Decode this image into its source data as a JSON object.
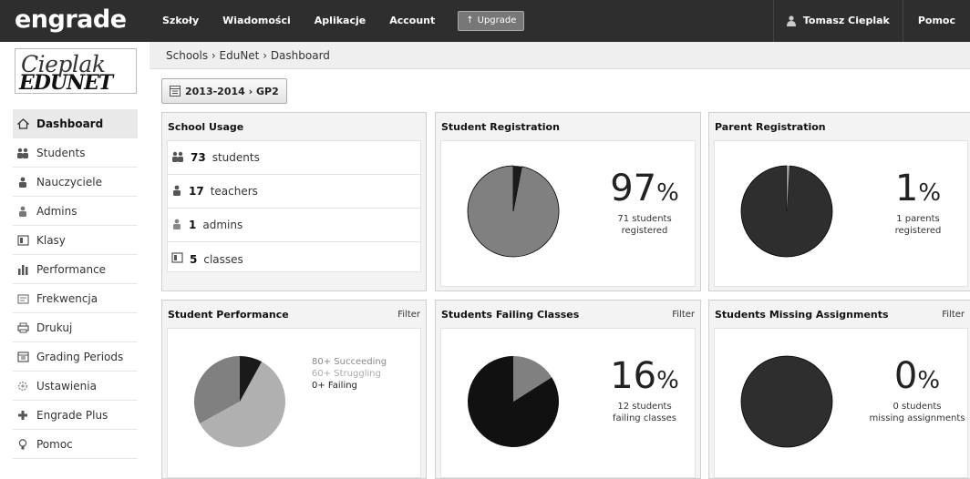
{
  "header": {
    "logo": "engrade",
    "nav": [
      "Szkoły",
      "Wiadomości",
      "Aplikacje",
      "Account"
    ],
    "upgrade_label": "Upgrade",
    "user_name": "Tomasz Cieplak",
    "help_label": "Pomoc"
  },
  "school_logo": {
    "line1": "Cieplak",
    "line2": "EDUNET"
  },
  "sidebar": {
    "items": [
      {
        "label": "Dashboard",
        "icon": "home-icon"
      },
      {
        "label": "Students",
        "icon": "students-icon"
      },
      {
        "label": "Nauczyciele",
        "icon": "teacher-icon"
      },
      {
        "label": "Admins",
        "icon": "admin-icon"
      },
      {
        "label": "Klasy",
        "icon": "class-icon"
      },
      {
        "label": "Performance",
        "icon": "performance-icon"
      },
      {
        "label": "Frekwencja",
        "icon": "attendance-icon"
      },
      {
        "label": "Drukuj",
        "icon": "print-icon"
      },
      {
        "label": "Grading Periods",
        "icon": "calendar-icon"
      },
      {
        "label": "Ustawienia",
        "icon": "gear-icon"
      },
      {
        "label": "Engrade Plus",
        "icon": "plus-icon"
      },
      {
        "label": "Pomoc",
        "icon": "help-icon"
      }
    ]
  },
  "breadcrumb": "Schools › EduNet › Dashboard",
  "period": "2013-2014 › GP2",
  "school_usage": {
    "title": "School Usage",
    "rows": [
      {
        "count": "73",
        "label": "students"
      },
      {
        "count": "17",
        "label": "teachers"
      },
      {
        "count": "1",
        "label": "admins"
      },
      {
        "count": "5",
        "label": "classes"
      }
    ]
  },
  "student_registration": {
    "title": "Student Registration",
    "value": "97",
    "unit": "%",
    "line1": "71 students",
    "line2": "registered",
    "fraction_registered": 0.97
  },
  "parent_registration": {
    "title": "Parent Registration",
    "value": "1",
    "unit": "%",
    "line1": "1 parents",
    "line2": "registered",
    "fraction_registered": 0.01
  },
  "student_performance": {
    "title": "Student Performance",
    "filter": "Filter",
    "legend": [
      "80+ Succeeding",
      "60+ Struggling",
      "0+ Failing"
    ],
    "colors": [
      "#808080",
      "#b0b0b0",
      "#1a1a1a"
    ]
  },
  "students_failing": {
    "title": "Students Failing Classes",
    "filter": "Filter",
    "value": "16",
    "unit": "%",
    "line1": "12 students",
    "line2": "failing classes",
    "fraction_failing": 0.16
  },
  "students_missing": {
    "title": "Students Missing Assignments",
    "filter": "Filter",
    "value": "0",
    "unit": "%",
    "line1": "0 students",
    "line2": "missing assignments",
    "fraction_missing": 0
  },
  "chart_data": [
    {
      "type": "pie",
      "title": "Student Registration",
      "slices": [
        {
          "label": "registered",
          "value": 97
        },
        {
          "label": "not registered",
          "value": 3
        }
      ]
    },
    {
      "type": "pie",
      "title": "Parent Registration",
      "slices": [
        {
          "label": "registered",
          "value": 1
        },
        {
          "label": "not registered",
          "value": 99
        }
      ]
    },
    {
      "type": "pie",
      "title": "Student Performance",
      "slices": [
        {
          "label": "80+ Succeeding",
          "value": 33
        },
        {
          "label": "60+ Struggling",
          "value": 59
        },
        {
          "label": "0+ Failing",
          "value": 8
        }
      ]
    },
    {
      "type": "pie",
      "title": "Students Failing Classes",
      "slices": [
        {
          "label": "failing",
          "value": 16
        },
        {
          "label": "not failing",
          "value": 84
        }
      ]
    },
    {
      "type": "pie",
      "title": "Students Missing Assignments",
      "slices": [
        {
          "label": "missing",
          "value": 0
        },
        {
          "label": "not missing",
          "value": 100
        }
      ]
    }
  ]
}
